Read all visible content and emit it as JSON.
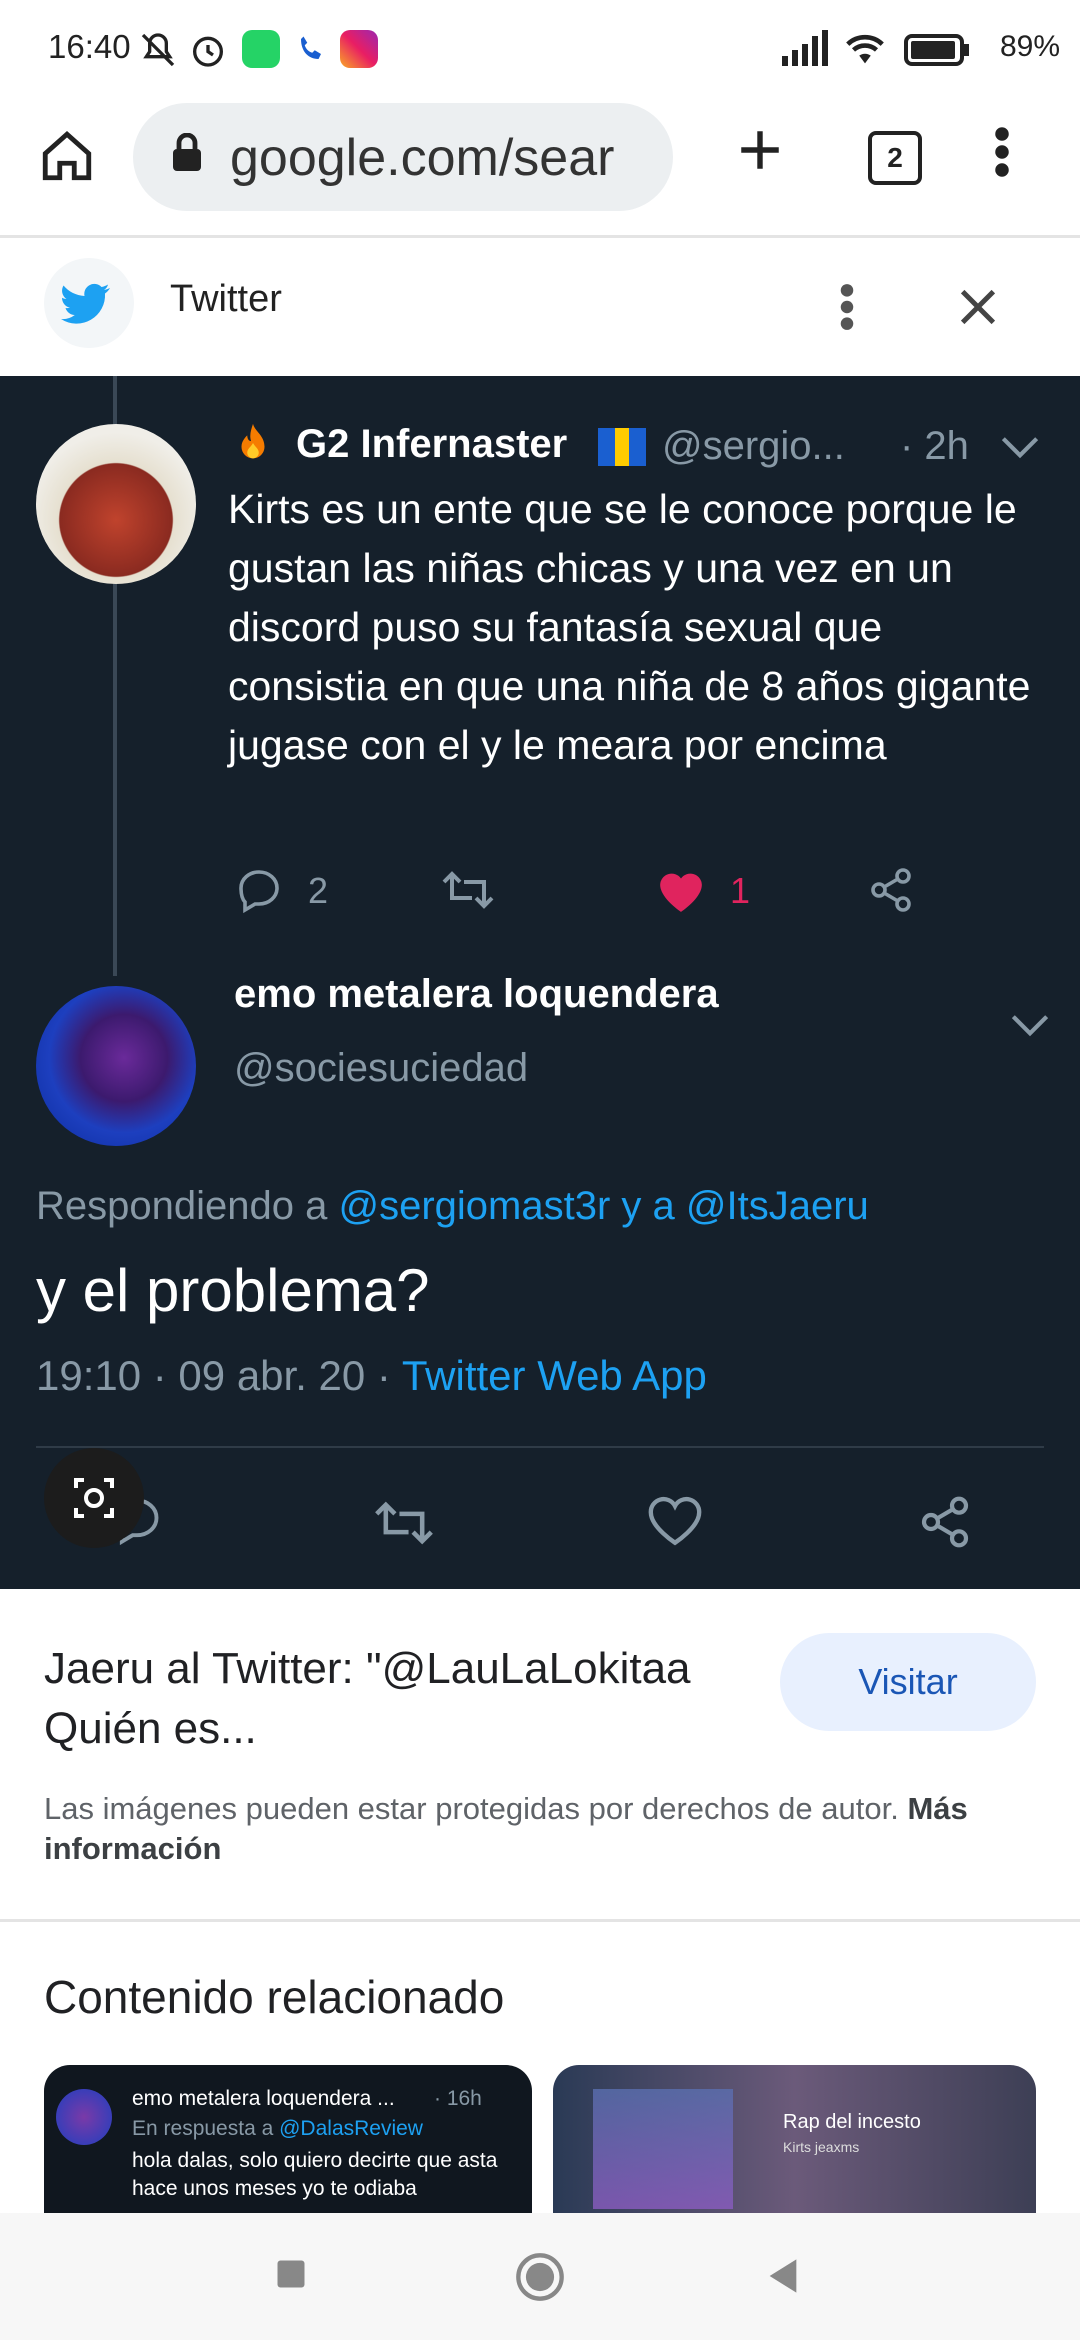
{
  "status_bar": {
    "time": "16:40",
    "battery": "89%"
  },
  "browser": {
    "url": "google.com/sear",
    "tab_count": "2"
  },
  "twitter_header": {
    "title": "Twitter"
  },
  "tweet1": {
    "display_name": "G2 Infernaster",
    "handle": "@sergio...",
    "age": "· 2h",
    "text": "Kirts es un ente que se le conoce porque le gustan las niñas chicas y una vez en un discord puso su fantasía sexual que consistia en que una niña de 8 años gigante jugase con el y le meara por encima",
    "reply_count": "2",
    "like_count": "1"
  },
  "tweet2": {
    "display_name": "emo metalera loquendera",
    "handle": "@sociesuciedad",
    "replying_prefix": "Respondiendo a",
    "replying_users": "@sergiomast3r y a @ItsJaeru",
    "text": "y el problema?",
    "timestamp": "19:10 · 09 abr. 20 ·",
    "source": "Twitter Web App"
  },
  "result": {
    "title": "Jaeru al Twitter: \"@LauLaLokitaa Quién es...",
    "visit_label": "Visitar",
    "disclaimer": "Las imágenes pueden estar protegidas por derechos de autor.",
    "more_info": "Más información"
  },
  "related": {
    "heading": "Contenido relacionado",
    "card1": {
      "name": "emo metalera loquendera ...",
      "age": "· 16h",
      "reply_prefix": "En respuesta a",
      "reply_user": "@DalasReview",
      "text": "hola dalas, solo quiero decirte que asta hace unos meses yo te odiaba"
    },
    "card2": {
      "label": "Rap del incesto",
      "sub": "Kirts jeaxms"
    }
  }
}
